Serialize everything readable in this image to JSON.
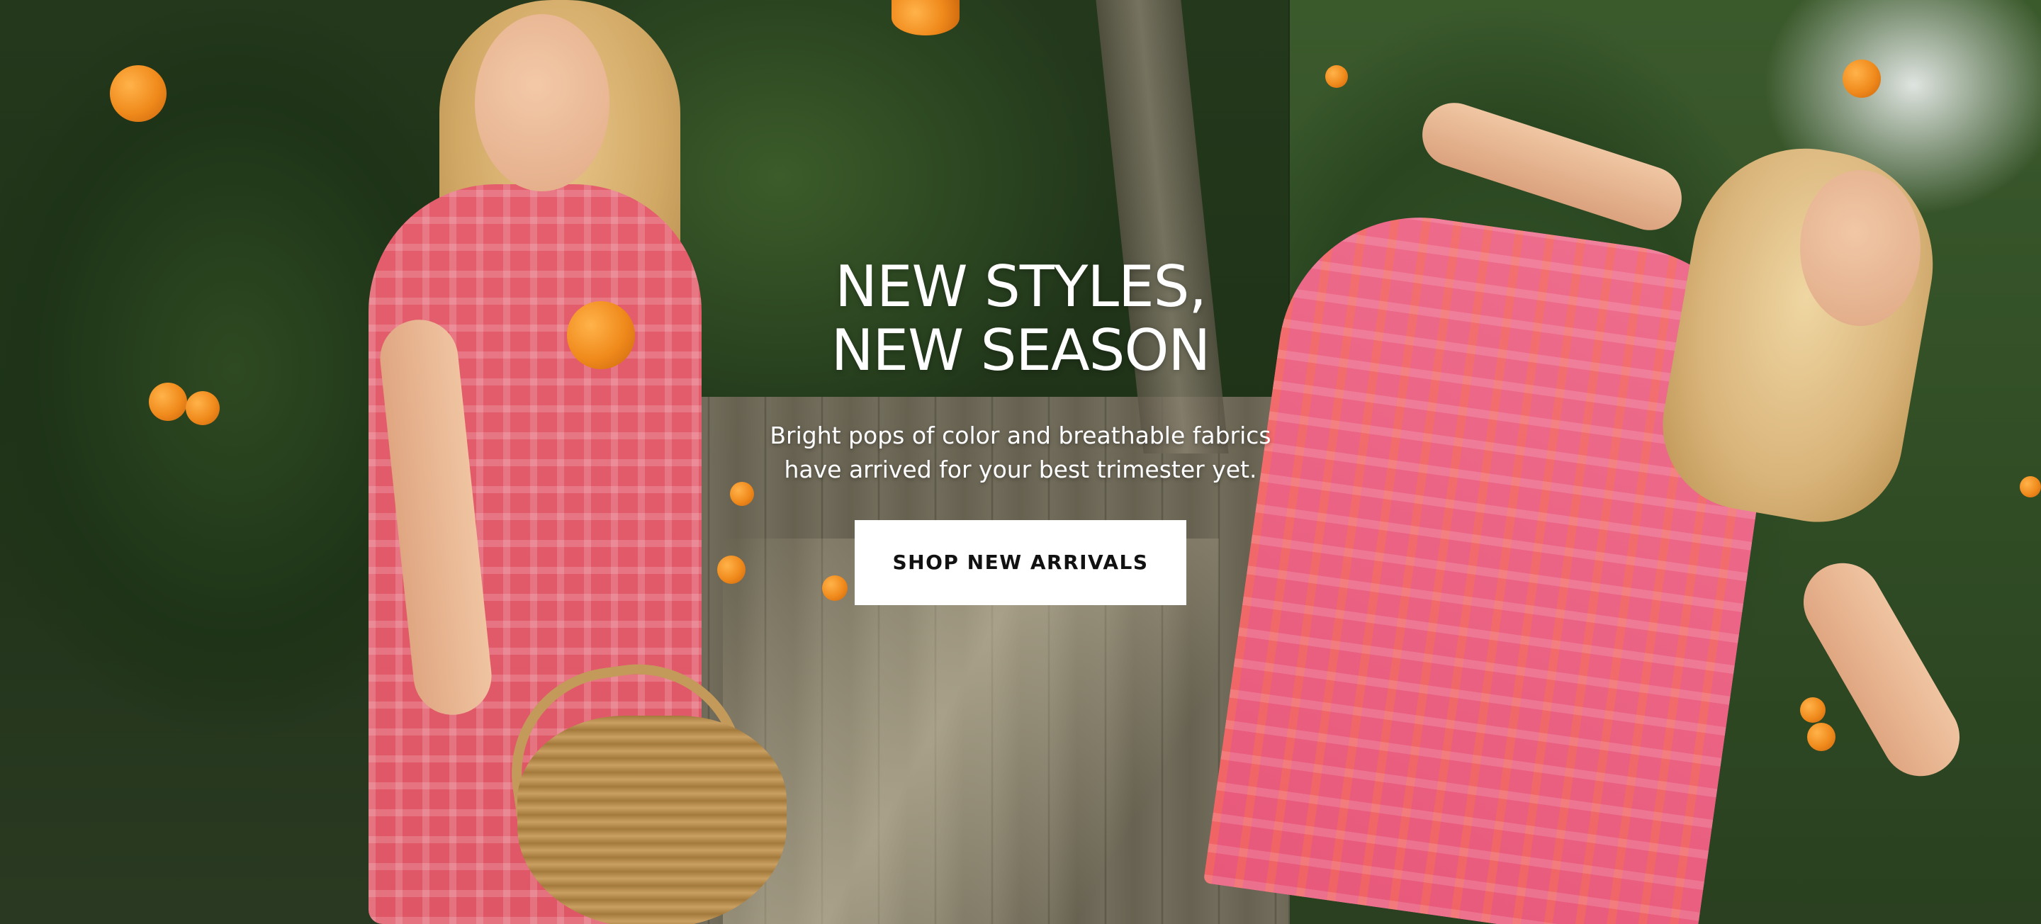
{
  "hero": {
    "headline_line1": "NEW STYLES,",
    "headline_line2": "NEW SEASON",
    "subtext_line1": "Bright pops of color and breathable fabrics",
    "subtext_line2": "have arrived for your best trimester yet.",
    "cta_label": "SHOP NEW ARRIVALS"
  },
  "colors": {
    "text": "#ffffff",
    "cta_background": "#ffffff",
    "cta_text": "#111111"
  }
}
